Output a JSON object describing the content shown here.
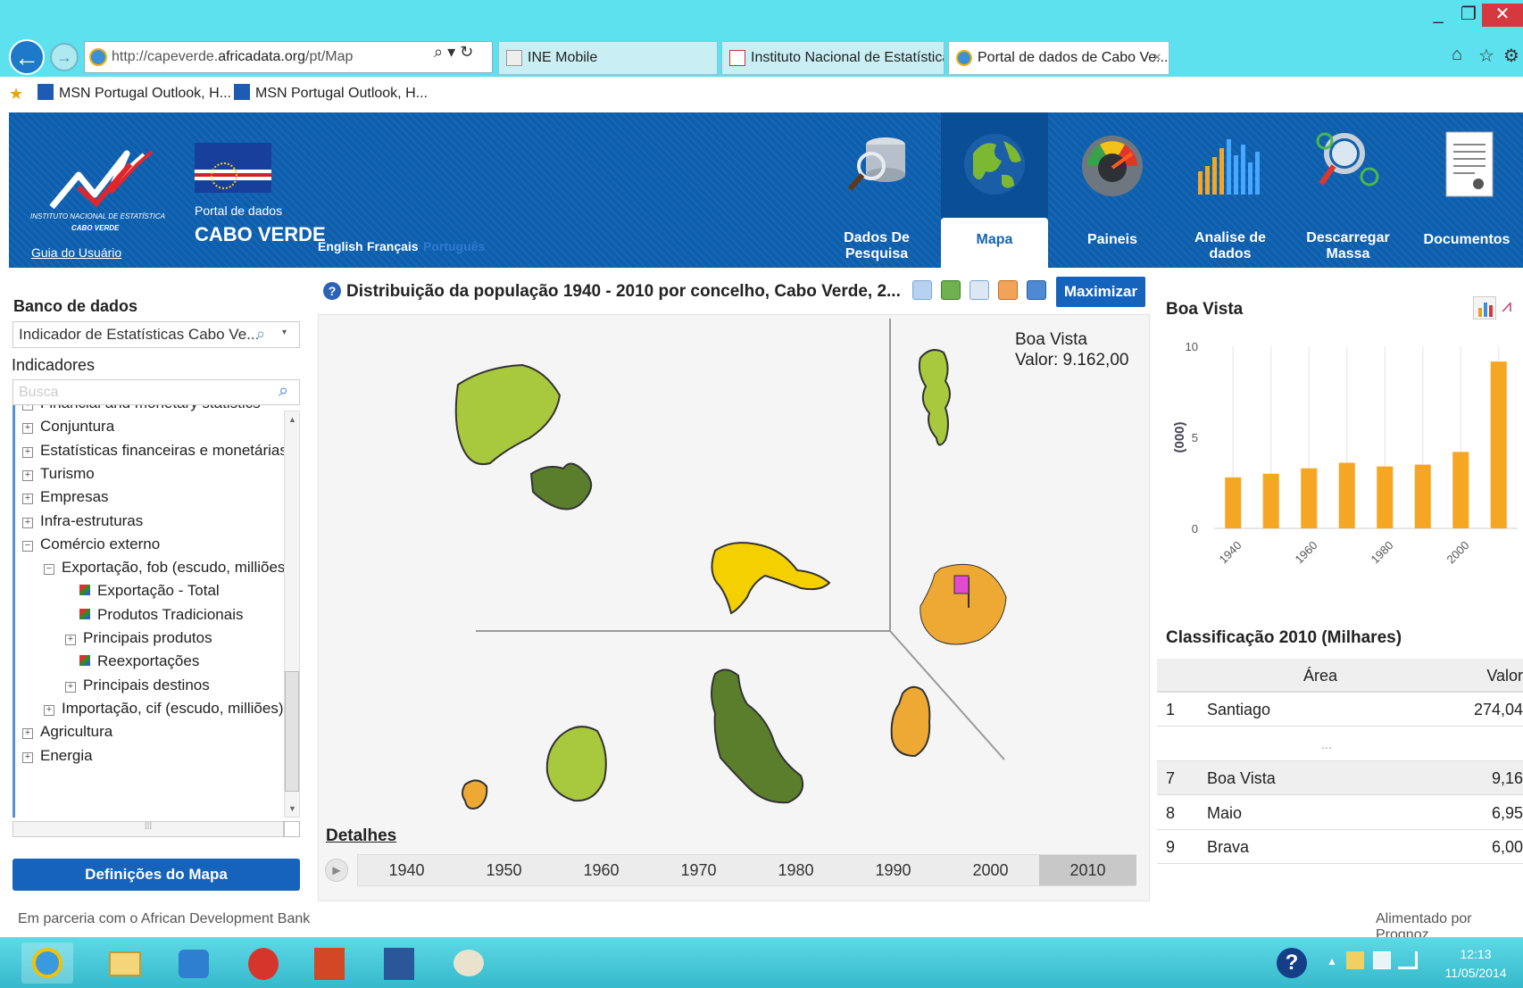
{
  "browser": {
    "address": "http://capeverde.africadata.org/pt/Map",
    "address_prefix": "http://capeverde.",
    "address_domain": "africadata.org",
    "address_suffix": "/pt/Map",
    "tabs": [
      {
        "label": "INE Mobile"
      },
      {
        "label": "Instituto Nacional de Estatística"
      },
      {
        "label": "Portal de dados de Cabo Ve...",
        "close": "×"
      }
    ],
    "favorites": [
      "MSN Portugal Outlook, H...",
      "MSN Portugal Outlook, H..."
    ]
  },
  "header": {
    "logo_line1": "INSTITUTO NACIONAL DE ESTATÍSTICA",
    "logo_line2": "CABO VERDE",
    "guide_link": "Guia do Usuário",
    "portal_small": "Portal de dados",
    "portal_big": "CABO VERDE",
    "languages": [
      "English",
      "Français",
      "Português"
    ],
    "nav": [
      {
        "label": "Dados De\nPesquisa",
        "icon": "database-search-icon"
      },
      {
        "label": "Mapa",
        "icon": "globe-icon"
      },
      {
        "label": "Paineis",
        "icon": "gauge-icon"
      },
      {
        "label": "Analise de\ndados",
        "icon": "bar-chart-icon"
      },
      {
        "label": "Descarregar\nMassa",
        "icon": "magnifier-icon"
      },
      {
        "label": "Documentos",
        "icon": "document-icon"
      }
    ]
  },
  "left": {
    "db_heading": "Banco de dados",
    "db_select": "Indicador de Estatísticas Cabo Ve...",
    "ind_heading": "Indicadores",
    "search_placeholder": "Busca",
    "tree": [
      {
        "label": "Financial and monetary statistics",
        "level": 0,
        "type": "plus"
      },
      {
        "label": "Conjuntura",
        "level": 0,
        "type": "plus"
      },
      {
        "label": "Estatísticas financeiras e monetárias",
        "level": 0,
        "type": "plus"
      },
      {
        "label": "Turismo",
        "level": 0,
        "type": "plus"
      },
      {
        "label": "Empresas",
        "level": 0,
        "type": "plus"
      },
      {
        "label": "Infra-estruturas",
        "level": 0,
        "type": "plus"
      },
      {
        "label": "Comércio externo",
        "level": 0,
        "type": "minus"
      },
      {
        "label": "Exportação, fob (escudo, milliões)",
        "level": 1,
        "type": "minus"
      },
      {
        "label": "Exportação - Total",
        "level": 2,
        "type": "leaf"
      },
      {
        "label": "Produtos Tradicionais",
        "level": 2,
        "type": "leaf"
      },
      {
        "label": "Principais produtos",
        "level": 2,
        "type": "plus"
      },
      {
        "label": "Reexportações",
        "level": 2,
        "type": "leaf"
      },
      {
        "label": "Principais destinos",
        "level": 2,
        "type": "plus"
      },
      {
        "label": "Importação, cif (escudo, milliões)",
        "level": 1,
        "type": "plus"
      },
      {
        "label": "Agricultura",
        "level": 0,
        "type": "plus"
      },
      {
        "label": "Energia",
        "level": 0,
        "type": "plus"
      }
    ],
    "map_settings_button": "Definições do Mapa"
  },
  "map": {
    "title": "Distribuição da população 1940 - 2010 por concelho, Cabo Verde, 2...",
    "maximize": "Maximizar",
    "tooltip_name": "Boa Vista",
    "tooltip_value": "Valor: 9.162,00",
    "details": "Detalhes",
    "years": [
      "1940",
      "1950",
      "1960",
      "1970",
      "1980",
      "1990",
      "2000",
      "2010"
    ],
    "selected_year": "2010",
    "colors": {
      "light_green": "#a8c83d",
      "dark_green": "#5b7e2d",
      "yellow": "#f5d000",
      "orange": "#eea935",
      "highlight": "#e24bd0"
    }
  },
  "right": {
    "title": "Boa Vista",
    "ranking_title": "Classificação 2010 (Milhares)",
    "ranking_headers": {
      "area": "Área",
      "value": "Valor"
    },
    "ranking": [
      {
        "rank": "1",
        "area": "Santiago",
        "value": "274,04"
      },
      {
        "rank": "",
        "area": "...",
        "value": ""
      },
      {
        "rank": "7",
        "area": "Boa Vista",
        "value": "9,16"
      },
      {
        "rank": "8",
        "area": "Maio",
        "value": "6,95"
      },
      {
        "rank": "9",
        "area": "Brava",
        "value": "6,00"
      }
    ]
  },
  "chart_data": {
    "type": "bar",
    "title": "Boa Vista",
    "ylabel": "(000)",
    "ylim": [
      0,
      10
    ],
    "yticks": [
      "0",
      "5",
      "10"
    ],
    "xticks": [
      "1940",
      "1960",
      "1980",
      "2000"
    ],
    "categories": [
      "1940",
      "1950",
      "1960",
      "1970",
      "1980",
      "1990",
      "2000",
      "2010"
    ],
    "values": [
      2.8,
      3.0,
      3.3,
      3.6,
      3.4,
      3.5,
      4.2,
      9.16
    ],
    "color": "#f5a623"
  },
  "footer": {
    "left": "Em parceria com o African Development Bank",
    "right": "Alimentado por Prognoz"
  },
  "taskbar": {
    "time": "12:13",
    "date": "11/05/2014"
  }
}
